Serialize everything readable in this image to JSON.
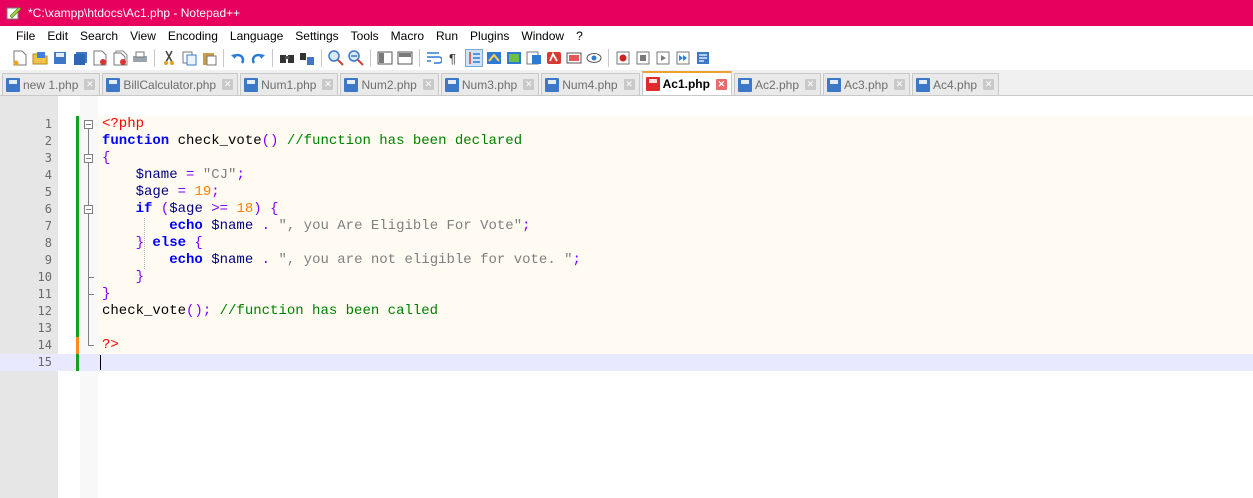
{
  "window": {
    "title": "*C:\\xampp\\htdocs\\Ac1.php - Notepad++"
  },
  "menu": [
    "File",
    "Edit",
    "Search",
    "View",
    "Encoding",
    "Language",
    "Settings",
    "Tools",
    "Macro",
    "Run",
    "Plugins",
    "Window",
    "?"
  ],
  "toolbar": {
    "icons": [
      "new-file-icon",
      "open-file-icon",
      "save-icon",
      "save-all-icon",
      "close-icon",
      "close-all-icon",
      "print-icon",
      "cut-icon",
      "copy-icon",
      "paste-icon",
      "undo-icon",
      "redo-icon",
      "find-icon",
      "replace-icon",
      "zoom-in-icon",
      "zoom-out-icon",
      "sync-vertical-icon",
      "sync-horizontal-icon",
      "word-wrap-icon",
      "show-all-chars-icon",
      "indent-guide-icon",
      "udl-icon",
      "doc-map-icon",
      "function-list-icon",
      "folder-workspace-icon",
      "monitor-icon",
      "eye-icon",
      "record-macro-icon",
      "stop-record-icon",
      "play-macro-icon",
      "run-macro-multiple-icon",
      "save-macro-icon"
    ]
  },
  "tabs": [
    {
      "label": "new 1.php",
      "active": false
    },
    {
      "label": "BillCalculator.php",
      "active": false
    },
    {
      "label": "Num1.php",
      "active": false
    },
    {
      "label": "Num2.php",
      "active": false
    },
    {
      "label": "Num3.php",
      "active": false
    },
    {
      "label": "Num4.php",
      "active": false
    },
    {
      "label": "Ac1.php",
      "active": true
    },
    {
      "label": "Ac2.php",
      "active": false
    },
    {
      "label": "Ac3.php",
      "active": false
    },
    {
      "label": "Ac4.php",
      "active": false
    }
  ],
  "editor": {
    "line_numbers": [
      "1",
      "2",
      "3",
      "4",
      "5",
      "6",
      "7",
      "8",
      "9",
      "10",
      "11",
      "12",
      "13",
      "14",
      "15"
    ],
    "lines": [
      [
        {
          "t": "<?php",
          "c": "t"
        }
      ],
      [
        {
          "t": "function",
          "c": "k"
        },
        {
          "t": " check_vote",
          "c": ""
        },
        {
          "t": "()",
          "c": "o"
        },
        {
          "t": " //function has been declared",
          "c": "c"
        }
      ],
      [
        {
          "t": "{",
          "c": "o"
        }
      ],
      [
        {
          "t": "    $name",
          "c": "v"
        },
        {
          "t": " = ",
          "c": "o"
        },
        {
          "t": "\"CJ\"",
          "c": "s"
        },
        {
          "t": ";",
          "c": "o"
        }
      ],
      [
        {
          "t": "    $age",
          "c": "v"
        },
        {
          "t": " = ",
          "c": "o"
        },
        {
          "t": "19",
          "c": "n"
        },
        {
          "t": ";",
          "c": "o"
        }
      ],
      [
        {
          "t": "    if",
          "c": "k"
        },
        {
          "t": " (",
          "c": "o"
        },
        {
          "t": "$age",
          "c": "v"
        },
        {
          "t": " >= ",
          "c": "o"
        },
        {
          "t": "18",
          "c": "n"
        },
        {
          "t": ") {",
          "c": "o"
        }
      ],
      [
        {
          "t": "        echo",
          "c": "k"
        },
        {
          "t": " $name",
          "c": "v"
        },
        {
          "t": " . ",
          "c": "o"
        },
        {
          "t": "\", you Are Eligible For Vote\"",
          "c": "s"
        },
        {
          "t": ";",
          "c": "o"
        }
      ],
      [
        {
          "t": "    } ",
          "c": "o"
        },
        {
          "t": "else",
          "c": "k"
        },
        {
          "t": " {",
          "c": "o"
        }
      ],
      [
        {
          "t": "        echo",
          "c": "k"
        },
        {
          "t": " $name",
          "c": "v"
        },
        {
          "t": " . ",
          "c": "o"
        },
        {
          "t": "\", you are not eligible for vote. \"",
          "c": "s"
        },
        {
          "t": ";",
          "c": "o"
        }
      ],
      [
        {
          "t": "    }",
          "c": "o"
        }
      ],
      [
        {
          "t": "}",
          "c": "o"
        }
      ],
      [
        {
          "t": "check_vote",
          "c": ""
        },
        {
          "t": "();",
          "c": "o"
        },
        {
          "t": " //function has been called",
          "c": "c"
        }
      ],
      [],
      [
        {
          "t": "?>",
          "c": "t"
        }
      ],
      []
    ],
    "colors": {
      "line_bg": "#fffbf2",
      "current_line_bg": "#e8e8ff",
      "saved_mark": "#16a022",
      "modified_mark": "#ff8a1e"
    }
  }
}
